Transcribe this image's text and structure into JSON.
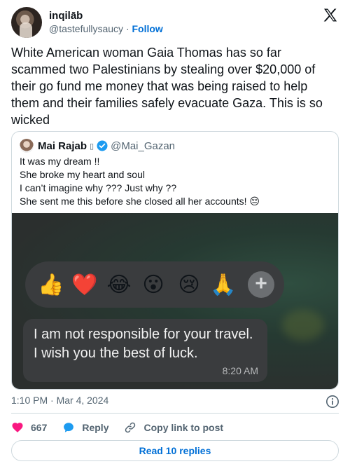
{
  "author": {
    "name": "inqilāb",
    "handle": "@tastefullysaucy",
    "separator": "·",
    "follow_label": "Follow"
  },
  "tweet": {
    "text": "White American woman Gaia Thomas has so far scammed two Palestinians by stealing over $20,000 of their go fund me money that was being raised to help them and their families safely evacuate Gaza. This is so wicked",
    "timestamp": "1:10 PM · Mar 4, 2024"
  },
  "quote": {
    "name": "Mai Rajab",
    "name_glyph": "▯",
    "handle": "@Mai_Gazan",
    "lines": [
      "It was my dream !!",
      "She broke my heart and soul",
      "I can’t imagine why ??? Just why ??",
      "She sent me this before she closed all her accounts! 😔"
    ],
    "media": {
      "reactions": [
        "👍",
        "❤️",
        "😂",
        "😮",
        "😢",
        "🙏"
      ],
      "plus_glyph": "+",
      "message": "I am not responsible for your travel. I wish you the best of luck.",
      "message_time": "8:20 AM"
    }
  },
  "actions": {
    "like_count": "667",
    "reply_label": "Reply",
    "copy_label": "Copy link to post"
  },
  "read_replies_label": "Read 10 replies",
  "colors": {
    "link": "#006fd6",
    "heart": "#f91880",
    "reply": "#1d9bf0",
    "verified": "#1d9bf0",
    "muted": "#536471"
  }
}
